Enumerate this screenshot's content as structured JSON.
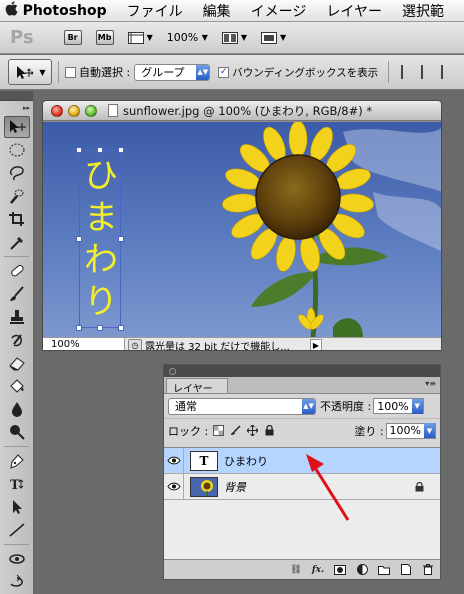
{
  "menubar": {
    "apple": "",
    "app_name": "Photoshop",
    "items": [
      "ファイル",
      "編集",
      "イメージ",
      "レイヤー",
      "選択範"
    ]
  },
  "appbar": {
    "logo": "Ps",
    "bridge": "Br",
    "minibridge": "Mb",
    "zoom": "100%"
  },
  "options": {
    "auto_select_label": "自動選択 :",
    "auto_select_value": "グループ",
    "bbox_label": "バウンディングボックスを表示",
    "bbox_checked": true
  },
  "document": {
    "title": "sunflower.jpg @ 100% (ひまわり, RGB/8#) *",
    "zoom": "100%",
    "status": "露光量は 32 bit だけで機能し...",
    "canvas_text": "ひまわり"
  },
  "layers_panel": {
    "tab": "レイヤー",
    "blend_mode": "通常",
    "opacity_label": "不透明度 :",
    "opacity_value": "100%",
    "lock_label": "ロック :",
    "fill_label": "塗り :",
    "fill_value": "100%",
    "layers": [
      {
        "name": "ひまわり",
        "thumb": "T",
        "selected": true
      },
      {
        "name": "背景",
        "selected": false
      }
    ],
    "footer_fx": "fx."
  },
  "colors": {
    "selection": "#b5d5ff",
    "annotation_arrow": "#e0101a",
    "canvas_text": "#f3ee2a"
  }
}
